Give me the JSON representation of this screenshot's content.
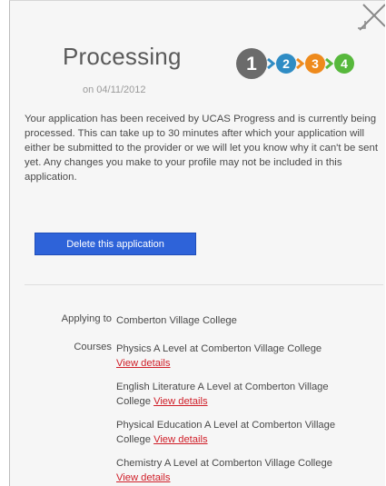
{
  "status": {
    "title": "Processing",
    "date": "on 04/11/2012"
  },
  "steps": [
    "1",
    "2",
    "3",
    "4"
  ],
  "step_colors": [
    "#6b6b6b",
    "#2f8cc4",
    "#ee8a1c",
    "#57b83c"
  ],
  "message": "Your application has been received by UCAS Progress and is currently being processed. This can take up to 30 minutes after which your application will either be submitted to the provider or we will let you know why it can't be sent yet. Any changes you make to your profile may not be included in this application.",
  "delete_button_label": "Delete this application",
  "applying_to": {
    "label": "Applying to",
    "value": "Comberton Village College"
  },
  "courses": {
    "label": "Courses",
    "link_label": "View details",
    "items": [
      {
        "name": "Physics A Level at Comberton Village College"
      },
      {
        "name": "English Literature A Level at Comberton Village College"
      },
      {
        "name": "Physical Education A Level at Comberton Village College"
      },
      {
        "name": "Chemistry A Level at Comberton Village College"
      }
    ]
  }
}
